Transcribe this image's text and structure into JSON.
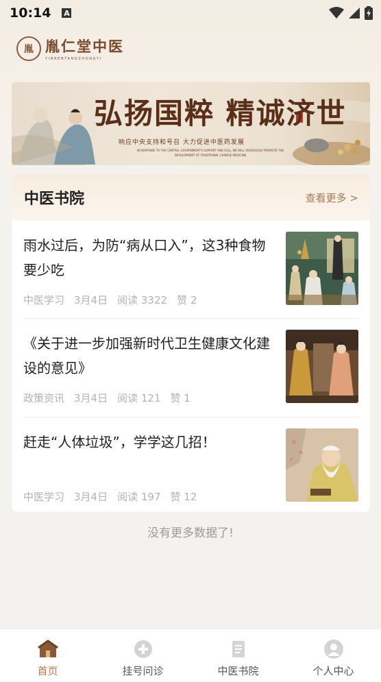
{
  "status_bar": {
    "time": "10:14",
    "indicator": "A"
  },
  "app": {
    "logo_seal": "胤",
    "logo_name": "胤仁堂中医",
    "logo_pinyin": "YINRENTANGZHONGYI"
  },
  "banner": {
    "headline": "弘扬国粹 精诚济世",
    "subline": "响应中央支持和号召 大力促进中医药发展",
    "english": "IN RESPONSE TO THE CENTRAL GOVERNMENT'S SUPPORT AND CALL, WE WILL VIGOROUSLY PROMOTE THE DEVELOPMENT OF TRADITIONAL CHINESE MEDICINE"
  },
  "section": {
    "title": "中医书院",
    "more_label": "查看更多 >"
  },
  "articles": [
    {
      "title": "雨水过后，为防“病从口入”，这3种食物要少吃",
      "category": "中医学习",
      "date": "3月4日",
      "reads": "阅读 3322",
      "likes": "赞 2"
    },
    {
      "title": "《关于进一步加强新时代卫生健康文化建设的意见》",
      "category": "政策资讯",
      "date": "3月4日",
      "reads": "阅读 121",
      "likes": "赞 1"
    },
    {
      "title": "赶走“人体垃圾”，学学这几招！",
      "category": "中医学习",
      "date": "3月4日",
      "reads": "阅读 197",
      "likes": "赞 12"
    }
  ],
  "footer_text": "没有更多数据了!",
  "tabbar": [
    {
      "label": "首页",
      "icon": "home-icon",
      "active": true
    },
    {
      "label": "挂号问诊",
      "icon": "consult-plus-icon",
      "active": false
    },
    {
      "label": "中医书院",
      "icon": "book-icon",
      "active": false
    },
    {
      "label": "个人中心",
      "icon": "person-icon",
      "active": false
    }
  ],
  "colors": {
    "accent": "#b8794a",
    "brand": "#7a4a2e"
  }
}
